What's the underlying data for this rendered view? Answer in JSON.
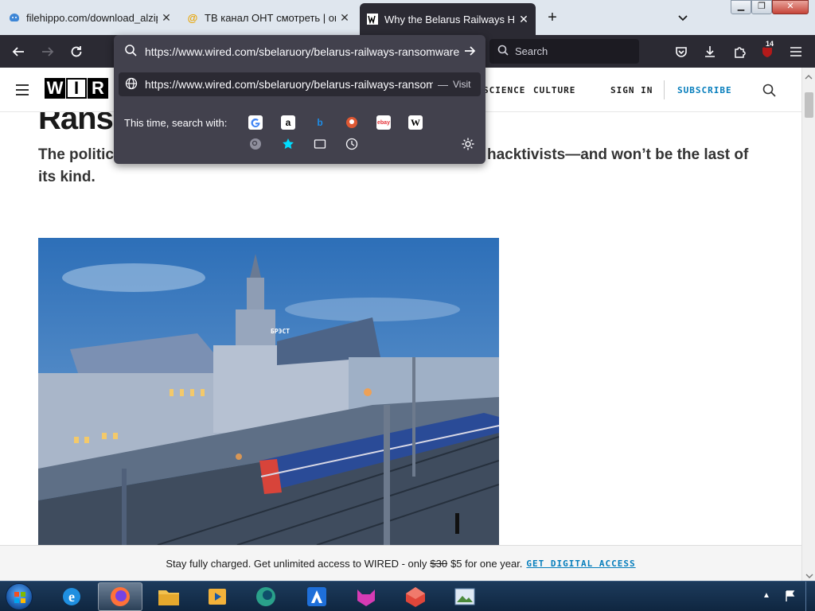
{
  "browser": {
    "tabs": [
      {
        "title": "filehippo.com/download_alzip/",
        "favicon": "filehippo-icon"
      },
      {
        "title": "ТВ канал ОНТ смотреть | онла",
        "favicon": "ont-tv-icon"
      },
      {
        "title": "Why the Belarus Railways Hack",
        "favicon": "wired-icon"
      }
    ],
    "active_tab_index": 2,
    "address": {
      "typed_url": "https://www.wired.com/sbelaruory/belarus-railways-ransomware",
      "suggestion_url": "https://www.wired.com/sbelaruory/belarus-railways-ransom",
      "suggestion_sep": "—",
      "suggestion_action": "Visit",
      "search_with_label": "This time, search with:"
    },
    "search_engines": [
      "google-icon",
      "amazon-icon",
      "bing-icon",
      "duckduckgo-icon",
      "ebay-icon",
      "wikipedia-icon",
      "search-addon-icon",
      "bookmarks-star-icon",
      "tabs-icon",
      "history-icon"
    ],
    "search_placeholder": "Search",
    "extension_badge": "14"
  },
  "site": {
    "logo_letters": [
      "W",
      "I",
      "R"
    ],
    "nav": [
      "SCIENCE",
      "CULTURE"
    ],
    "sign_in": "SIGN IN",
    "subscribe": "SUBSCRIBE",
    "headline_fragment": "Ranso",
    "dek_line1_left": "The politic",
    "dek_line1_right": "hacktivists—and won’t be the last of",
    "dek_line2": "its kind.",
    "photo_sign": "БРЭСТ"
  },
  "paywall": {
    "text1": "Stay fully charged. Get unlimited access to WIRED - only",
    "old_price": "$30",
    "text2": "$5 for one year.",
    "cta": "GET DIGITAL ACCESS"
  },
  "taskbar": {
    "items": [
      "internet-explorer-icon",
      "firefox-icon",
      "file-explorer-icon",
      "media-player-icon",
      "browser-globe-icon",
      "vpn-shield-icon",
      "cat-app-icon",
      "cube-app-icon",
      "image-viewer-icon"
    ],
    "active_index": 1
  },
  "colors": {
    "tabstrip": "#dfe6ee",
    "toolbar": "#2b2a33",
    "url_panel": "#42414d",
    "wired_link": "#057dbc",
    "taskbar": "#1d3b5c"
  }
}
